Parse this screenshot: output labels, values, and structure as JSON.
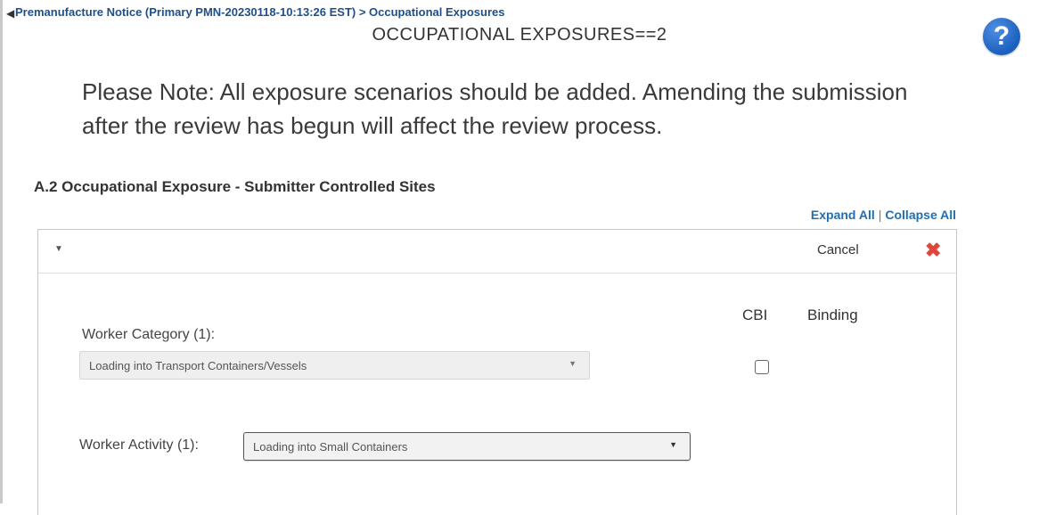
{
  "breadcrumb": "Premanufacture Notice (Primary PMN-20230118-10:13:26 EST) > Occupational Exposures",
  "page_title": "OCCUPATIONAL EXPOSURES==2",
  "note": "Please Note: All exposure scenarios should be added. Amending the submission after the review has begun will affect the review process.",
  "section_title": "A.2 Occupational Exposure - Submitter Controlled Sites",
  "links": {
    "expand_all": "Expand All",
    "separator": "|",
    "collapse_all": "Collapse All"
  },
  "panel": {
    "cancel_label": "Cancel",
    "columns": {
      "cbi": "CBI",
      "binding": "Binding"
    },
    "worker_category": {
      "label": "Worker Category (1):",
      "value": "Loading into Transport Containers/Vessels",
      "cbi_checked": false
    },
    "worker_activity": {
      "label": "Worker Activity (1):",
      "value": "Loading into Small Containers"
    }
  },
  "icons": {
    "help": "help-icon",
    "close": "close-icon",
    "caret": "caret-down-icon",
    "collapse": "chevron-left-icon"
  },
  "colors": {
    "link": "#1f6fb2",
    "breadcrumb": "#1f4f8a",
    "close": "#e0463c",
    "help": "#1b5fbf"
  }
}
